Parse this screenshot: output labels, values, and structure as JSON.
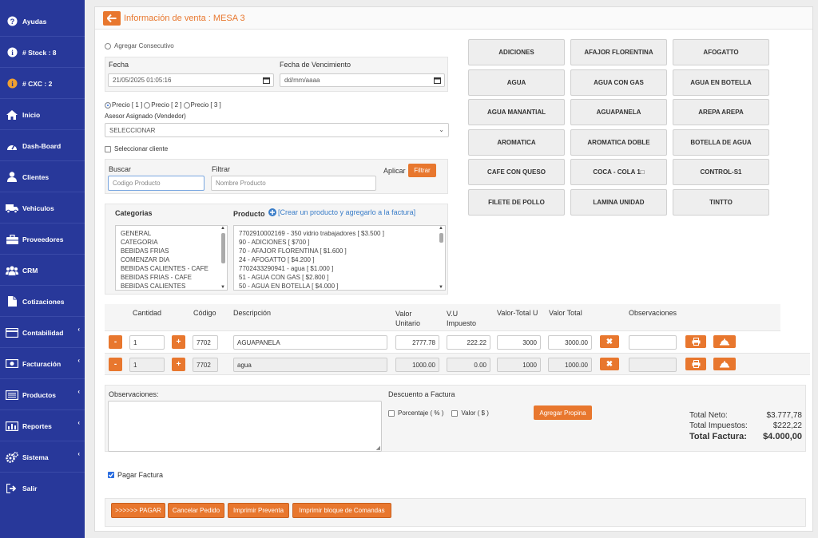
{
  "sidebar": {
    "items": [
      {
        "label": "Ayudas",
        "icon": "question-icon"
      },
      {
        "label": "# Stock : 8",
        "icon": "info-icon"
      },
      {
        "label": "# CXC : 2",
        "icon": "info-icon"
      },
      {
        "label": "Inicio",
        "icon": "home-icon"
      },
      {
        "label": "Dash-Board",
        "icon": "dashboard-icon"
      },
      {
        "label": "Clientes",
        "icon": "user-icon"
      },
      {
        "label": "Vehiculos",
        "icon": "truck-icon"
      },
      {
        "label": "Proveedores",
        "icon": "briefcase-icon"
      },
      {
        "label": "CRM",
        "icon": "users-icon"
      },
      {
        "label": "Cotizaciones",
        "icon": "file-icon"
      },
      {
        "label": "Contabilidad",
        "icon": "card-icon"
      },
      {
        "label": "Facturación",
        "icon": "money-icon"
      },
      {
        "label": "Productos",
        "icon": "list-icon"
      },
      {
        "label": "Reportes",
        "icon": "chart-icon"
      },
      {
        "label": "Sistema",
        "icon": "gears-icon"
      },
      {
        "label": "Salir",
        "icon": "signout-icon"
      }
    ]
  },
  "header": {
    "title": "Información de venta : MESA 3"
  },
  "form": {
    "agregar_consecutivo": "Agregar Consecutivo",
    "fecha_label": "Fecha",
    "fecha_value": "21/05/2025 01:05:16",
    "venc_label": "Fecha de Vencimiento",
    "venc_value": "dd/mm/aaaa",
    "precio1": "Precio [ 1 ]",
    "precio2": "Precio [ 2 ]",
    "precio3": "Precio [ 3 ]",
    "asesor_label": "Asesor Asignado (Vendedor)",
    "asesor_value": "SELECCIONAR",
    "seleccionar_cliente": "Seleccionar cliente",
    "buscar_label": "Buscar",
    "buscar_placeholder": "Codigo Producto",
    "filtrar_label": "Filtrar",
    "filtrar_placeholder": "Nombre Producto",
    "aplicar_label": "Aplicar",
    "filtrar_button": "Filtrar"
  },
  "categorias": {
    "label": "Categorias",
    "items": [
      "GENERAL",
      "CATEGORIA",
      "BEBIDAS FRIAS",
      "COMENZAR DIA",
      "BEBIDAS CALIENTES - CAFE",
      "BEBIDAS FRIAS - CAFE",
      "BEBIDAS CALIENTES"
    ]
  },
  "producto": {
    "label": "Producto",
    "create_link": "[Crear un producto y agregarlo a la factura]",
    "items": [
      "7702910002169 - 350 vidrio trabajadores [ $3.500 ]",
      "90 - ADICIONES [ $700 ]",
      "70 - AFAJOR FLORENTINA [ $1.600 ]",
      "24 - AFOGATTO [ $4.200 ]",
      "7702433290941 - agua [ $1.000 ]",
      "51 - AGUA CON GAS [ $2.800 ]",
      "50 - AGUA EN BOTELLA [ $4.000 ]"
    ]
  },
  "quick_products": [
    "ADICIONES",
    "AFAJOR FLORENTINA",
    "AFOGATTO",
    "AGUA",
    "AGUA CON GAS",
    "AGUA EN BOTELLA",
    "AGUA MANANTIAL",
    "AGUAPANELA",
    "AREPA AREPA",
    "AROMATICA",
    "AROMATICA DOBLE",
    "BOTELLA DE AGUA",
    "CAFE CON QUESO",
    "COCA - COLA 1□",
    "CONTROL-S1",
    "FILETE DE POLLO",
    "LAMINA UNIDAD",
    "TINTTO"
  ],
  "table": {
    "headers": {
      "cantidad": "Cantidad",
      "codigo": "Código",
      "descripcion": "Descripción",
      "valor_unitario": "Valor Unitario",
      "vu_impuesto": "V.U Impuesto",
      "valor_total_u": "Valor-Total U",
      "valor_total": "Valor Total",
      "observaciones": "Observaciones"
    },
    "rows": [
      {
        "qty": "1",
        "code": "7702",
        "desc": "AGUAPANELA",
        "vu": "2777.78",
        "imp": "222.22",
        "vtu": "3000",
        "vt": "3000.00",
        "obs": ""
      },
      {
        "qty": "1",
        "code": "7702",
        "desc": "agua",
        "vu": "1000.00",
        "imp": "0.00",
        "vtu": "1000",
        "vt": "1000.00",
        "obs": ""
      }
    ]
  },
  "bottom": {
    "observaciones_label": "Observaciones:",
    "descuento_label": "Descuento a Factura",
    "porcentaje": "Porcentaje ( % )",
    "valor": "Valor ( $ )",
    "agregar_propina": "Agregar Propina",
    "total_neto_label": "Total Neto:",
    "total_neto": "$3.777,78",
    "total_impuestos_label": "Total Impuestos:",
    "total_impuestos": "$222,22",
    "total_factura_label": "Total Factura:",
    "total_factura": "$4.000,00",
    "pagar_factura": "Pagar Factura"
  },
  "footer": {
    "pagar": ">>>>>> PAGAR",
    "cancelar": "Cancelar Pedido",
    "imprimir_preventa": "Imprimir Preventa",
    "imprimir_bloque": "Imprimir bloque de Comandas"
  },
  "colors": {
    "sidebar": "#28389a",
    "accent": "#e8772e"
  }
}
